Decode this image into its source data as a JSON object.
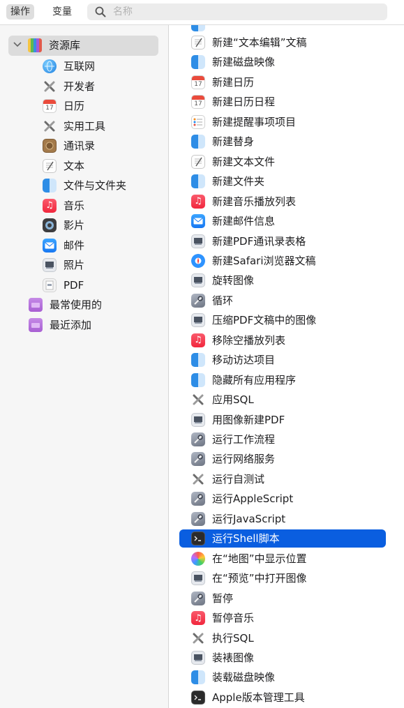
{
  "toolbar": {
    "tab_actions": "操作",
    "tab_variables": "变量",
    "search_placeholder": "名称"
  },
  "sidebar": {
    "library_label": "资源库",
    "items": [
      {
        "label": "互联网",
        "icon": "globe-icon"
      },
      {
        "label": "开发者",
        "icon": "tools-icon"
      },
      {
        "label": "日历",
        "icon": "calendar-icon"
      },
      {
        "label": "实用工具",
        "icon": "tools-icon"
      },
      {
        "label": "通讯录",
        "icon": "contacts-icon"
      },
      {
        "label": "文本",
        "icon": "text-document-icon"
      },
      {
        "label": "文件与文件夹",
        "icon": "finder-icon"
      },
      {
        "label": "音乐",
        "icon": "music-icon"
      },
      {
        "label": "影片",
        "icon": "movies-icon"
      },
      {
        "label": "邮件",
        "icon": "mail-icon"
      },
      {
        "label": "照片",
        "icon": "preview-icon"
      },
      {
        "label": "PDF",
        "icon": "pdf-icon"
      }
    ],
    "smart_groups": [
      {
        "label": "最常使用的",
        "icon": "folder-icon"
      },
      {
        "label": "最近添加",
        "icon": "folder-icon"
      }
    ]
  },
  "actions": [
    {
      "label": "新建“文本编辑”文稿",
      "icon": "text-document-icon"
    },
    {
      "label": "新建磁盘映像",
      "icon": "finder-icon"
    },
    {
      "label": "新建日历",
      "icon": "calendar-icon"
    },
    {
      "label": "新建日历日程",
      "icon": "calendar-icon"
    },
    {
      "label": "新建提醒事项项目",
      "icon": "reminders-icon"
    },
    {
      "label": "新建替身",
      "icon": "finder-icon"
    },
    {
      "label": "新建文本文件",
      "icon": "text-document-icon"
    },
    {
      "label": "新建文件夹",
      "icon": "finder-icon"
    },
    {
      "label": "新建音乐播放列表",
      "icon": "music-icon"
    },
    {
      "label": "新建邮件信息",
      "icon": "mail-icon"
    },
    {
      "label": "新建PDF通讯录表格",
      "icon": "preview-icon"
    },
    {
      "label": "新建Safari浏览器文稿",
      "icon": "safari-icon"
    },
    {
      "label": "旋转图像",
      "icon": "preview-icon"
    },
    {
      "label": "循环",
      "icon": "automator-icon"
    },
    {
      "label": "压缩PDF文稿中的图像",
      "icon": "preview-icon"
    },
    {
      "label": "移除空播放列表",
      "icon": "music-icon"
    },
    {
      "label": "移动访达项目",
      "icon": "finder-icon"
    },
    {
      "label": "隐藏所有应用程序",
      "icon": "finder-icon"
    },
    {
      "label": "应用SQL",
      "icon": "tools-icon"
    },
    {
      "label": "用图像新建PDF",
      "icon": "preview-icon"
    },
    {
      "label": "运行工作流程",
      "icon": "automator-icon"
    },
    {
      "label": "运行网络服务",
      "icon": "automator-icon"
    },
    {
      "label": "运行自测试",
      "icon": "tools-icon"
    },
    {
      "label": "运行AppleScript",
      "icon": "automator-icon"
    },
    {
      "label": "运行JavaScript",
      "icon": "automator-icon"
    },
    {
      "label": "运行Shell脚本",
      "icon": "terminal-icon",
      "selected": true
    },
    {
      "label": "在“地图”中显示位置",
      "icon": "maps-icon"
    },
    {
      "label": "在“预览”中打开图像",
      "icon": "preview-icon"
    },
    {
      "label": "暂停",
      "icon": "automator-icon"
    },
    {
      "label": "暂停音乐",
      "icon": "music-icon"
    },
    {
      "label": "执行SQL",
      "icon": "tools-icon"
    },
    {
      "label": "装裱图像",
      "icon": "preview-icon"
    },
    {
      "label": "装载磁盘映像",
      "icon": "finder-icon"
    },
    {
      "label": "Apple版本管理工具",
      "icon": "terminal-icon"
    }
  ],
  "colors": {
    "selection": "#0a5ee0",
    "sidebar_bg": "#f6f6f6",
    "library_highlight": "#dcdcdc"
  }
}
